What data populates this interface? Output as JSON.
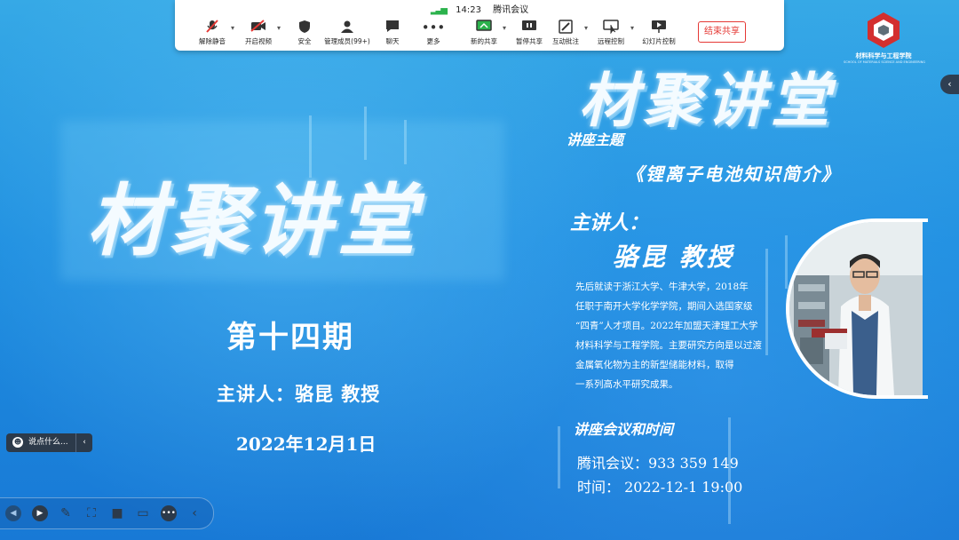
{
  "toolbar": {
    "signal_icon": "signal-bars-icon",
    "time": "14:23",
    "app_title": "腾讯会议",
    "buttons": [
      {
        "label": "解除静音",
        "icon": "mic-muted-icon"
      },
      {
        "label": "开启视频",
        "icon": "video-off-icon"
      },
      {
        "label": "安全",
        "icon": "shield-icon"
      },
      {
        "label": "管理成员(99+)",
        "icon": "people-icon"
      },
      {
        "label": "聊天",
        "icon": "chat-icon"
      },
      {
        "label": "更多",
        "icon": "more-icon"
      },
      {
        "label": "新的共享",
        "icon": "share-screen-icon"
      },
      {
        "label": "暂停共享",
        "icon": "pause-icon"
      },
      {
        "label": "互动批注",
        "icon": "annotate-icon"
      },
      {
        "label": "远程控制",
        "icon": "remote-control-icon"
      },
      {
        "label": "幻灯片控制",
        "icon": "slideshow-icon"
      }
    ],
    "end_share_label": "结束共享",
    "end_share_color": "#e53935"
  },
  "logo": {
    "name": "材料科学与工程学院",
    "subtitle": "SCHOOL OF MATERIALS SCIENCE AND ENGINEERING"
  },
  "slide": {
    "left_title": "材聚讲堂",
    "issue": "第十四期",
    "speaker_left": "主讲人：骆昆 教授",
    "date_left": "2022年12月1日",
    "right_title": "材聚讲堂",
    "topic_label": "讲座主题",
    "topic": "《锂离子电池知识简介》",
    "speaker_label": "主讲人：",
    "speaker_name": "骆昆 教授",
    "bio_lines": [
      "先后就读于浙江大学、牛津大学，2018年",
      "任职于南开大学化学学院，期间入选国家级",
      "“四青”人才项目。2022年加盟天津理工大学",
      "材料科学与工程学院。主要研究方向是以过渡",
      "金属氧化物为主的新型储能材料，取得",
      "一系列高水平研究成果。"
    ],
    "meeting_label": "讲座会议和时间",
    "meeting_id_line": "腾讯会议：933 359 149",
    "meeting_time_line": "时间：  2022-12-1 19:00"
  },
  "chat": {
    "placeholder": "说点什么...",
    "emoji_icon": "emoji-icon",
    "collapse_icon": "chevron-left-icon"
  },
  "side_toggle_icon": "chevron-left-icon",
  "bottom_tools": [
    "prev-icon",
    "play-icon",
    "pen-icon",
    "screenshot-icon",
    "camera-icon",
    "comment-icon",
    "more-icon",
    "collapse-icon"
  ]
}
